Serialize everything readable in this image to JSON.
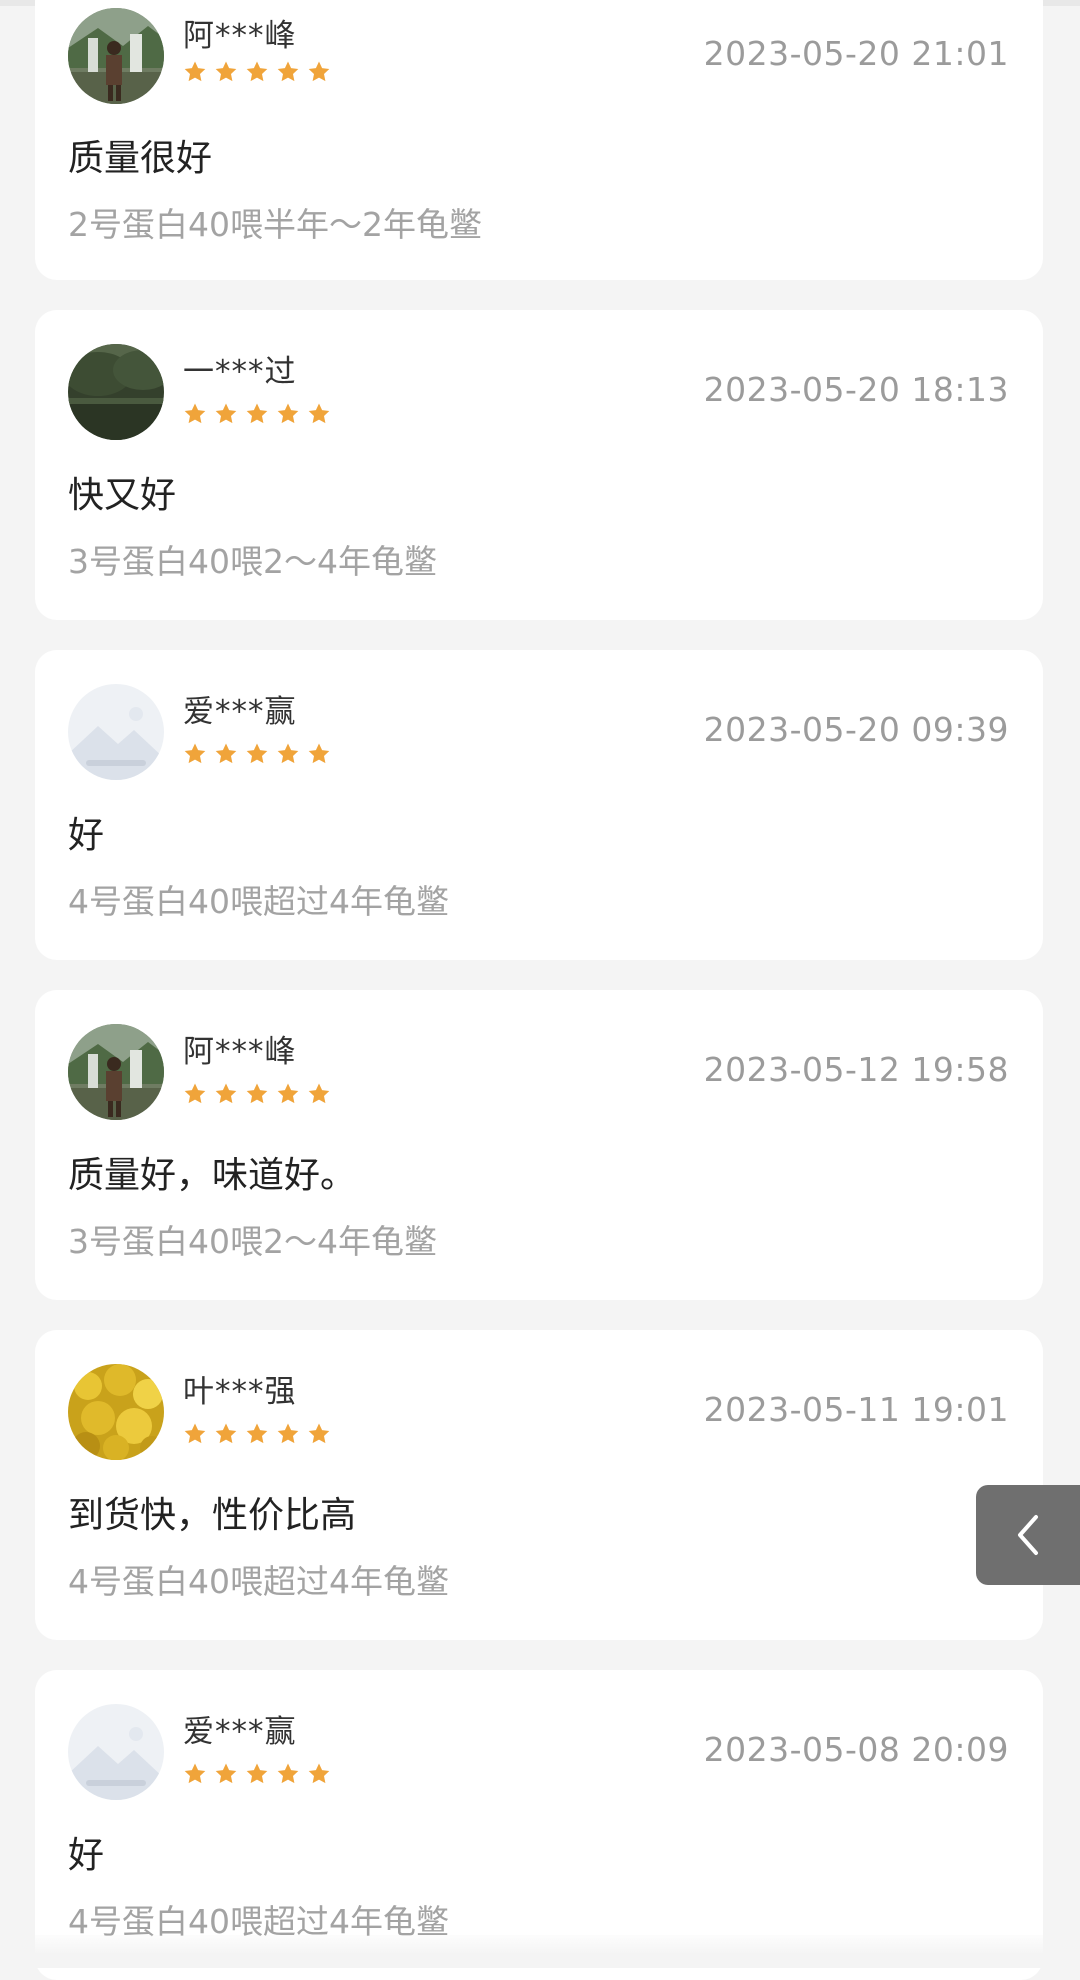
{
  "colors": {
    "star": "#f0a43a",
    "date": "#9b9b9b",
    "spec": "#a3a3a3",
    "side_tab": "#6f6f6f"
  },
  "reviews": [
    {
      "user": "阿***峰",
      "date": "2023-05-20 21:01",
      "rating": 5,
      "comment": "质量很好",
      "spec": "2号蛋白40喂半年～2年龟鳖",
      "avatar": "waterfall-photo-avatar"
    },
    {
      "user": "一***过",
      "date": "2023-05-20 18:13",
      "rating": 5,
      "comment": "快又好",
      "spec": "3号蛋白40喂2～4年龟鳖",
      "avatar": "landscape-photo-avatar"
    },
    {
      "user": "爱***赢",
      "date": "2023-05-20 09:39",
      "rating": 5,
      "comment": "好",
      "spec": "4号蛋白40喂超过4年龟鳖",
      "avatar": "placeholder-avatar"
    },
    {
      "user": "阿***峰",
      "date": "2023-05-12 19:58",
      "rating": 5,
      "comment": "质量好，味道好。",
      "spec": "3号蛋白40喂2～4年龟鳖",
      "avatar": "waterfall-photo-avatar"
    },
    {
      "user": "叶***强",
      "date": "2023-05-11 19:01",
      "rating": 5,
      "comment": "到货快，性价比高",
      "spec": "4号蛋白40喂超过4年龟鳖",
      "avatar": "yellow-flowers-avatar"
    },
    {
      "user": "爱***赢",
      "date": "2023-05-08 20:09",
      "rating": 5,
      "comment": "好",
      "spec": "4号蛋白40喂超过4年龟鳖",
      "avatar": "placeholder-avatar"
    }
  ],
  "side_tab": {
    "icon": "chevron-left-icon"
  }
}
